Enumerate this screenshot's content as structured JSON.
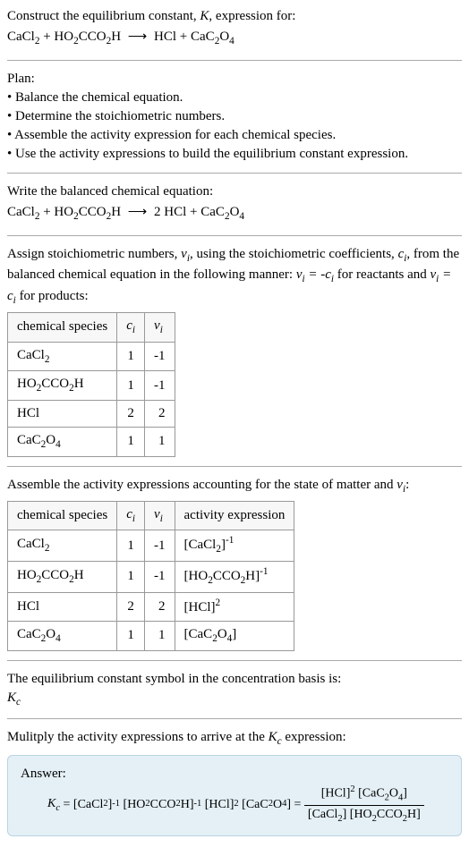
{
  "intro": {
    "line1_prefix": "Construct the equilibrium constant, ",
    "line1_k": "K",
    "line1_suffix": ", expression for:"
  },
  "plan": {
    "heading": "Plan:",
    "b1": "• Balance the chemical equation.",
    "b2": "• Determine the stoichiometric numbers.",
    "b3": "• Assemble the activity expression for each chemical species.",
    "b4": "• Use the activity expressions to build the equilibrium constant expression."
  },
  "balanced_heading": "Write the balanced chemical equation:",
  "stoich": {
    "p1_a": "Assign stoichiometric numbers, ",
    "p1_b": ", using the stoichiometric coefficients, ",
    "p1_c": ", from the balanced chemical equation in the following manner: ",
    "p1_d": " for reactants and ",
    "p1_e": " for products:"
  },
  "table1": {
    "h1": "chemical species",
    "r1": {
      "ci": "1",
      "vi": "-1"
    },
    "r2": {
      "ci": "1",
      "vi": "-1"
    },
    "r3": {
      "sp": "HCl",
      "ci": "2",
      "vi": "2"
    },
    "r4": {
      "ci": "1",
      "vi": "1"
    }
  },
  "activity_heading_a": "Assemble the activity expressions accounting for the state of matter and ",
  "activity_heading_b": ":",
  "table2": {
    "h1": "chemical species",
    "h4": "activity expression",
    "r1": {
      "ci": "1",
      "vi": "-1"
    },
    "r2": {
      "ci": "1",
      "vi": "-1"
    },
    "r3": {
      "sp": "HCl",
      "ci": "2",
      "vi": "2"
    },
    "r4": {
      "ci": "1",
      "vi": "1"
    }
  },
  "eq_const": {
    "line1": "The equilibrium constant symbol in the concentration basis is:"
  },
  "multiply": {
    "text_a": "Mulitply the activity expressions to arrive at the ",
    "text_b": " expression:"
  },
  "answer": {
    "label": "Answer:"
  }
}
